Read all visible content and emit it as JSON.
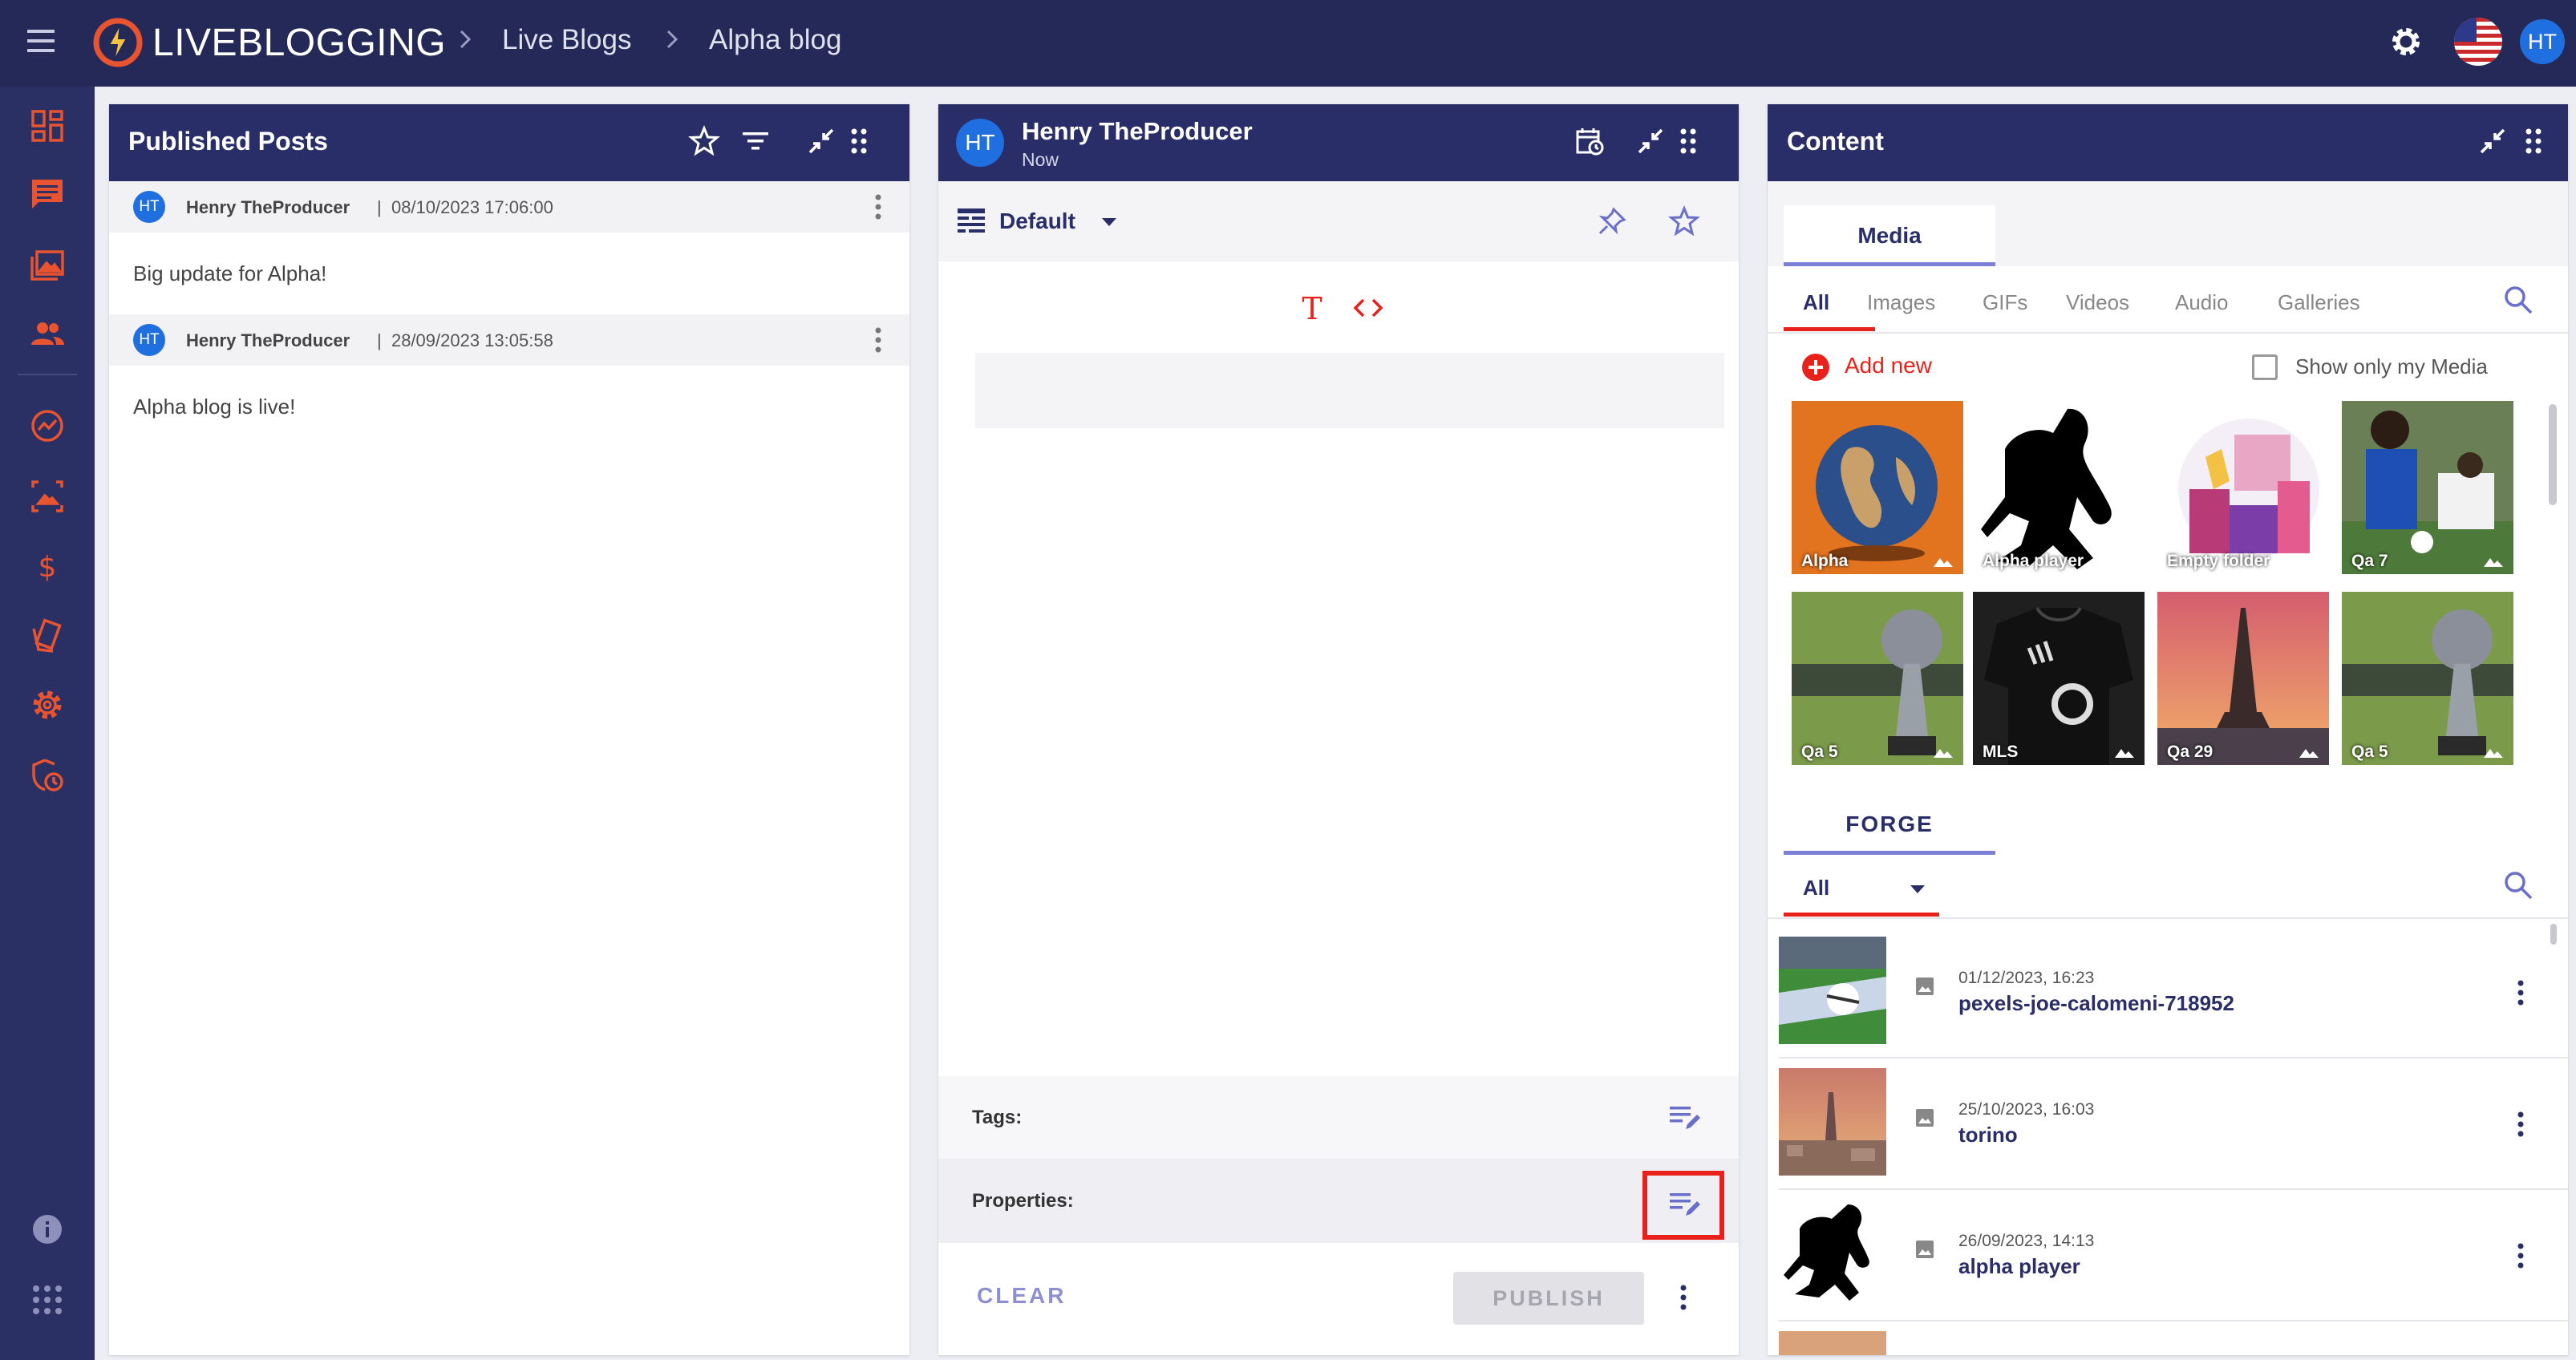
{
  "header": {
    "logo_text": "LIVEBLOGGING",
    "breadcrumb": [
      "Live Blogs",
      "Alpha blog"
    ],
    "user_initials": "HT"
  },
  "sidebar": {
    "items": [
      "dashboard-icon",
      "posts-icon",
      "media-icon",
      "users-icon",
      "analytics-icon",
      "gallery-icon",
      "billing-icon",
      "tags-icon",
      "settings-icon",
      "security-icon",
      "info-icon",
      "apps-icon"
    ]
  },
  "published": {
    "title": "Published Posts",
    "posts": [
      {
        "initials": "HT",
        "author": "Henry TheProducer",
        "date": "08/10/2023 17:06:00",
        "text": "Big update for Alpha!"
      },
      {
        "initials": "HT",
        "author": "Henry TheProducer",
        "date": "28/09/2023 13:05:58",
        "text": "Alpha blog is live!"
      }
    ]
  },
  "editor": {
    "author_initials": "HT",
    "author": "Henry TheProducer",
    "time": "Now",
    "layout": "Default",
    "tags_label": "Tags:",
    "properties_label": "Properties:",
    "clear": "CLEAR",
    "publish": "PUBLISH"
  },
  "content": {
    "title": "Content",
    "media_tab": "Media",
    "subtabs": [
      "All",
      "Images",
      "GIFs",
      "Videos",
      "Audio",
      "Galleries"
    ],
    "add_new": "Add new",
    "show_only_mine": "Show only my Media",
    "media": [
      "Alpha",
      "Alpha player",
      "Empty folder",
      "Qa 7",
      "Qa 5",
      "MLS",
      "Qa 29",
      "Qa 5"
    ],
    "forge_tab": "FORGE",
    "forge_filter": "All",
    "forge_items": [
      {
        "date": "01/12/2023, 16:23",
        "name": "pexels-joe-calomeni-718952"
      },
      {
        "date": "25/10/2023, 16:03",
        "name": "torino"
      },
      {
        "date": "26/09/2023, 14:13",
        "name": "alpha player"
      }
    ]
  },
  "colors": {
    "topbar": "#252958",
    "sidebar": "#2a2f64",
    "accent": "#e8542f",
    "highlight": "#e8211a",
    "avatar": "#1f6fe0"
  }
}
